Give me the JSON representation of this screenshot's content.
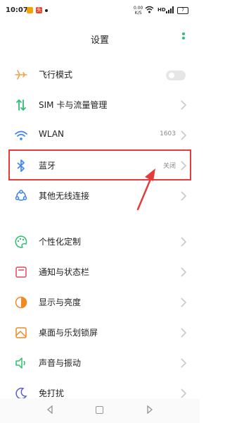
{
  "status_bar": {
    "time": "10:07",
    "app2_text": "头",
    "speed_value": "0.00",
    "speed_unit": "K/S",
    "network_label": "HD",
    "battery": "7"
  },
  "header": {
    "title": "设置"
  },
  "rows": [
    {
      "id": "airplane",
      "label": "飞行模式",
      "value": "",
      "icon": "airplane-icon",
      "toggle": "off"
    },
    {
      "id": "sim",
      "label": "SIM 卡与流量管理",
      "value": "",
      "icon": "sim-data-icon"
    },
    {
      "id": "wlan",
      "label": "WLAN",
      "value": "1603",
      "icon": "wifi-icon"
    },
    {
      "id": "bluetooth",
      "label": "蓝牙",
      "value": "关闭",
      "icon": "bluetooth-icon"
    },
    {
      "id": "other-wireless",
      "label": "其他无线连接",
      "value": "",
      "icon": "connections-icon"
    },
    {
      "id": "personalization",
      "label": "个性化定制",
      "value": "",
      "icon": "palette-icon"
    },
    {
      "id": "notification",
      "label": "通知与状态栏",
      "value": "",
      "icon": "notification-icon"
    },
    {
      "id": "display",
      "label": "显示与亮度",
      "value": "",
      "icon": "brightness-icon"
    },
    {
      "id": "wallpaper",
      "label": "桌面与乐划锁屏",
      "value": "",
      "icon": "wallpaper-icon"
    },
    {
      "id": "sound",
      "label": "声音与振动",
      "value": "",
      "icon": "sound-icon"
    },
    {
      "id": "dnd",
      "label": "免打扰",
      "value": "",
      "icon": "moon-icon"
    }
  ],
  "colors": {
    "accent_green": "#2fbf71",
    "highlight_red": "#e53b3b"
  }
}
